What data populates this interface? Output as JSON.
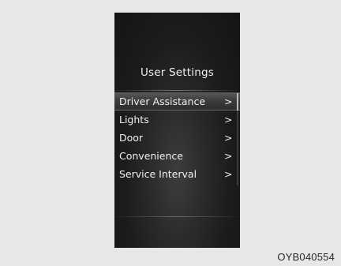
{
  "screen": {
    "title": "User Settings",
    "menu_items": [
      {
        "label": "Driver Assistance",
        "arrow": ">",
        "selected": true
      },
      {
        "label": "Lights",
        "arrow": ">",
        "selected": false
      },
      {
        "label": "Door",
        "arrow": ">",
        "selected": false
      },
      {
        "label": "Convenience",
        "arrow": ">",
        "selected": false
      },
      {
        "label": "Service Interval",
        "arrow": ">",
        "selected": false
      }
    ]
  },
  "figure_code": "OYB040554",
  "colors": {
    "background": "#e7e7e8",
    "screen": "#171717",
    "text": "#f0f0f0",
    "highlight": "#4a4a4a"
  }
}
